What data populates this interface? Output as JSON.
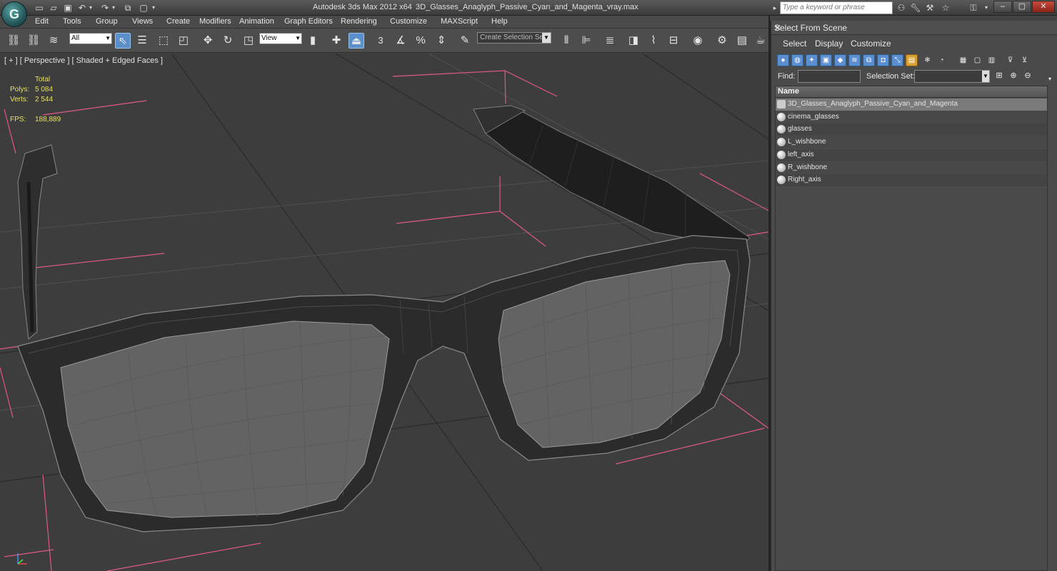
{
  "titlebar": {
    "app_logo": "G",
    "app_name": "Autodesk 3ds Max  2012 x64",
    "file_name": "3D_Glasses_Anaglyph_Passive_Cyan_and_Magenta_vray.max",
    "search_placeholder": "Type a keyword or phrase",
    "win_minimize": "–",
    "win_maximize": "▢",
    "win_close": "✕"
  },
  "menu": {
    "items": [
      "Edit",
      "Tools",
      "Group",
      "Views",
      "Create",
      "Modifiers",
      "Animation",
      "Graph Editors",
      "Rendering",
      "Customize",
      "MAXScript",
      "Help"
    ]
  },
  "toolbar": {
    "filter_value": "All",
    "reference_coord": "View",
    "selection_set_placeholder": "Create Selection Se",
    "snap_3": "3"
  },
  "viewport": {
    "label": "[ + ] [ Perspective ] [ Shaded + Edged Faces ]",
    "stats": {
      "total_header": "Total",
      "polys_label": "Polys:",
      "polys_value": "5 084",
      "verts_label": "Verts:",
      "verts_value": "2 544",
      "fps_label": "FPS:",
      "fps_value": "188,889"
    }
  },
  "dialog": {
    "title": "Select From Scene",
    "close": "✕",
    "menu": [
      "Select",
      "Display",
      "Customize"
    ],
    "find_label": "Find:",
    "find_value": "",
    "selection_set_label": "Selection Set:",
    "selection_set_value": "",
    "column_name": "Name",
    "objects": [
      {
        "name": "3D_Glasses_Anaglyph_Passive_Cyan_and_Magenta",
        "type": "group",
        "highlighted": true
      },
      {
        "name": "cinema_glasses",
        "type": "object",
        "highlighted": false
      },
      {
        "name": "glasses",
        "type": "object",
        "highlighted": false
      },
      {
        "name": "L_wishbone",
        "type": "object",
        "highlighted": false
      },
      {
        "name": "left_axis",
        "type": "object",
        "highlighted": false
      },
      {
        "name": "R_wishbone",
        "type": "object",
        "highlighted": false
      },
      {
        "name": "Right_axis",
        "type": "object",
        "highlighted": false
      }
    ]
  },
  "colors": {
    "selection_blue": "#5a8fc9",
    "stats_yellow": "#e8e060",
    "bbox_pink": "#e0588a",
    "viewport_bg": "#3d3d3d"
  }
}
